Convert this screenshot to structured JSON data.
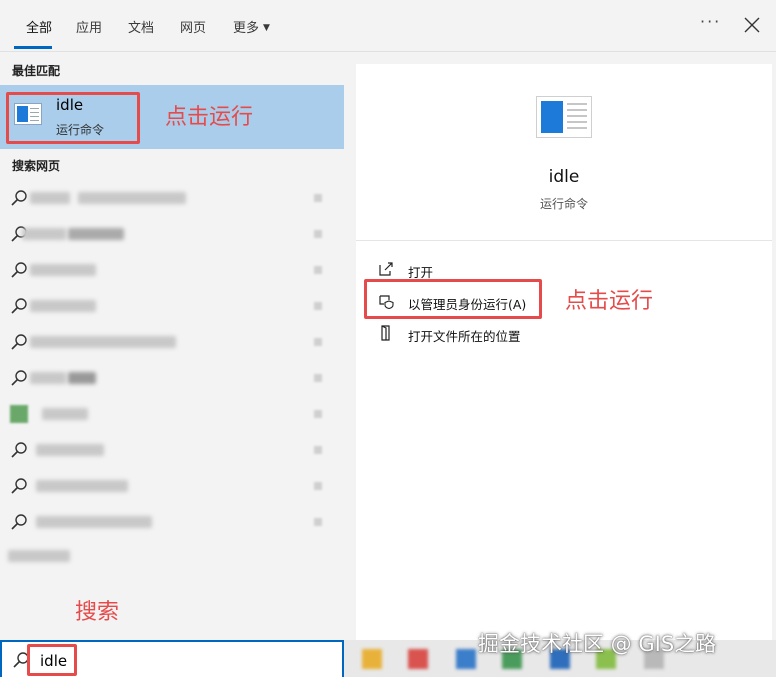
{
  "tabs": [
    {
      "label": "全部"
    },
    {
      "label": "应用"
    },
    {
      "label": "文档"
    },
    {
      "label": "网页"
    },
    {
      "label": "更多"
    }
  ],
  "more_options": "···",
  "left": {
    "best_match_title": "最佳匹配",
    "best_match": {
      "name": "idle",
      "type": "运行命令"
    },
    "web_title": "搜索网页"
  },
  "right": {
    "app_name": "idle",
    "app_type": "运行命令",
    "actions": [
      {
        "label": "打开",
        "icon": "open-icon"
      },
      {
        "label": "以管理员身份运行(A)",
        "icon": "shield-icon"
      },
      {
        "label": "打开文件所在的位置",
        "icon": "file-location-icon"
      }
    ]
  },
  "search": {
    "value": "idle"
  },
  "annotations": {
    "run_click_1": "点击运行",
    "run_click_2": "点击运行",
    "search_label": "搜索"
  },
  "watermark": "掘金技术社区 @ GIS之路",
  "colors": {
    "accent": "#0067c0",
    "selection": "#a9cdea",
    "annotation": "#e64b4b"
  }
}
